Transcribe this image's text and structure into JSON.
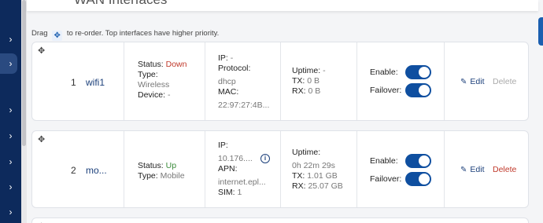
{
  "sidebar": {
    "chevron": "›",
    "items": [
      "›",
      "›",
      "›",
      "›",
      "›",
      "›",
      "›"
    ]
  },
  "section": {
    "title": "WAN Interfaces"
  },
  "hint": {
    "before": "Drag",
    "after": "to re-order. Top interfaces have higher priority.",
    "drag_icon": "drag-move-icon"
  },
  "labels": {
    "status": "Status:",
    "type": "Type:",
    "device": "Device:",
    "ip": "IP:",
    "protocol": "Protocol:",
    "mac": "MAC:",
    "apn": "APN:",
    "sim": "SIM:",
    "uptime": "Uptime:",
    "tx": "TX:",
    "rx": "RX:",
    "enable": "Enable:",
    "failover": "Failover:",
    "edit": "Edit",
    "delete": "Delete"
  },
  "interfaces": [
    {
      "index": "1",
      "name": "wifi1",
      "status": "Down",
      "type": "Wireless",
      "device": "-",
      "ip": "-",
      "protocol": "dhcp",
      "mac": "22:97:27:4B...",
      "uptime": "-",
      "tx": "0 B",
      "rx": "0 B",
      "enable": true,
      "failover": true,
      "delete_enabled": false
    },
    {
      "index": "2",
      "name": "mo...",
      "status": "Up",
      "type": "Mobile",
      "ip": "10.176....",
      "apn": "internet.epl...",
      "sim": "1",
      "uptime": "0h 22m 29s",
      "tx": "1.01 GB",
      "rx": "25.07 GB",
      "enable": true,
      "failover": true,
      "delete_enabled": true
    }
  ],
  "colors": {
    "sidebar": "#0d2a5c",
    "accent": "#0f4fa0",
    "down": "#c0392b",
    "up": "#3a8a3a"
  }
}
